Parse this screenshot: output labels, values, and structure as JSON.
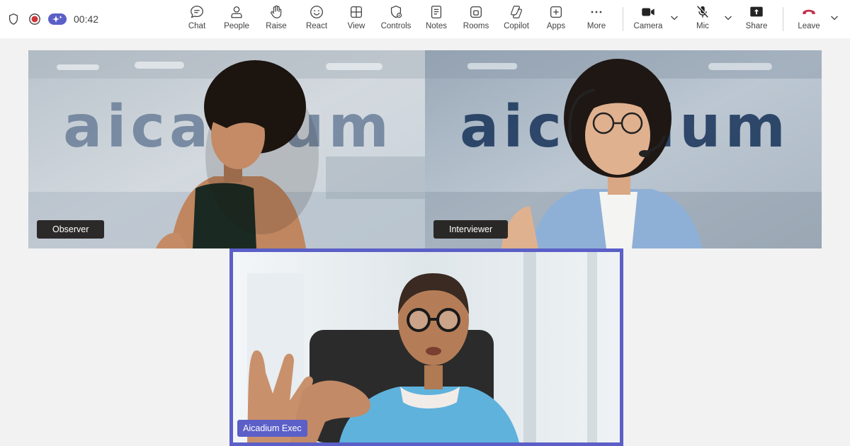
{
  "status": {
    "timer": "00:42"
  },
  "toolbar": {
    "chat": "Chat",
    "people": "People",
    "raise": "Raise",
    "react": "React",
    "view": "View",
    "controls": "Controls",
    "notes": "Notes",
    "rooms": "Rooms",
    "copilot": "Copilot",
    "apps": "Apps",
    "more": "More",
    "camera": "Camera",
    "mic": "Mic",
    "share": "Share",
    "leave": "Leave"
  },
  "participants": {
    "observer": {
      "name": "Observer",
      "background_text": "aicadium"
    },
    "interviewer": {
      "name": "Interviewer",
      "background_text": "aicadium"
    },
    "exec": {
      "name": "Aicadium Exec"
    }
  },
  "colors": {
    "accent": "#5b5fc7",
    "record": "#d13438",
    "leave": "#c4314b",
    "brand_text_light": "#6b7f99",
    "brand_text_dark": "#1f3a5f"
  }
}
